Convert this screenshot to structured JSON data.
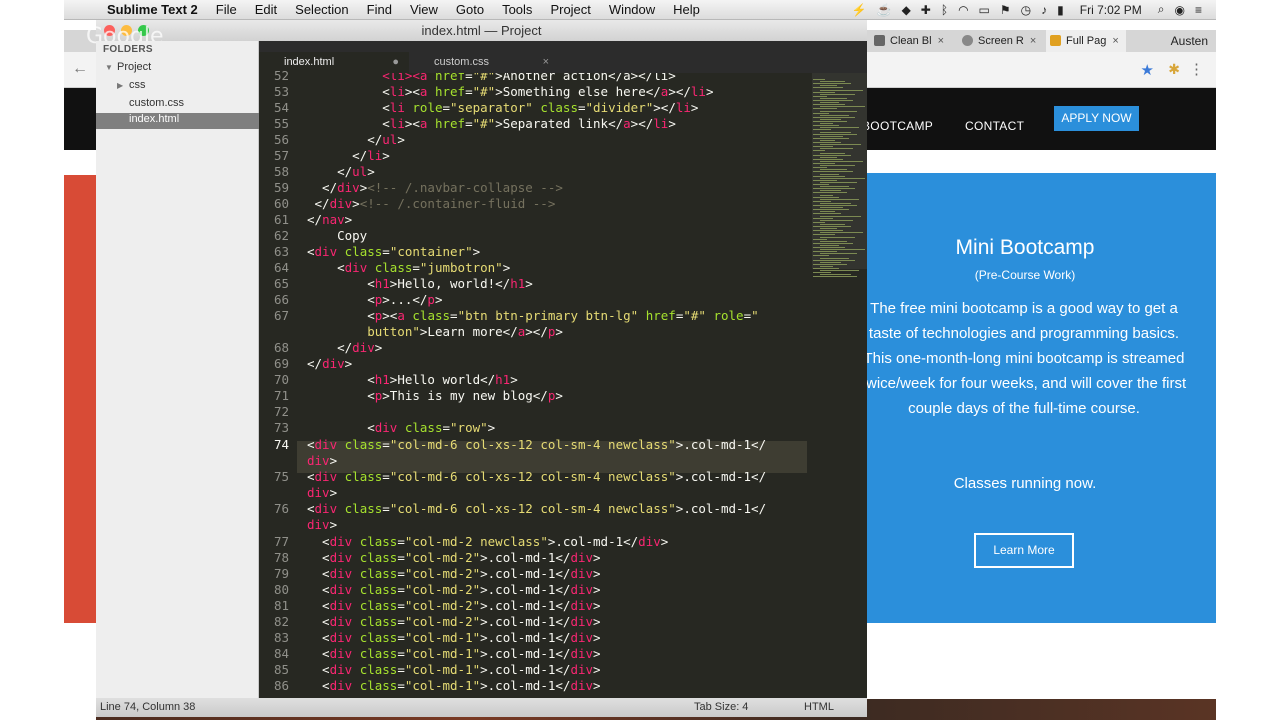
{
  "menubar": {
    "app": "Sublime Text 2",
    "items": [
      "File",
      "Edit",
      "Selection",
      "Find",
      "View",
      "Goto",
      "Tools",
      "Project",
      "Window",
      "Help"
    ],
    "clock": "Fri 7:02 PM"
  },
  "browser": {
    "tabs": [
      "Clean Bl",
      "Screen R",
      "Full Pag"
    ],
    "user": "Austen",
    "nav": {
      "bootcamp": "BOOTCAMP",
      "contact": "CONTACT",
      "apply": "APPLY NOW"
    },
    "hero": {
      "title": "Mini Bootcamp",
      "subtitle": "(Pre-Course Work)",
      "body": "The free mini bootcamp is a good way to get a taste of technologies and programming basics. This one-month-long mini bootcamp is streamed twice/week for four weeks, and will cover the first couple days of the full-time course.",
      "note": "Classes running now.",
      "button": "Learn More"
    },
    "colors": {
      "nav": "#111111",
      "hero": "#2b8fdb",
      "red": "#d84b36"
    }
  },
  "sublime": {
    "title": "index.html — Project",
    "overlay": "Google",
    "sidebar": {
      "header": "FOLDERS",
      "project": "Project",
      "items": [
        "css",
        "custom.css",
        "index.html"
      ],
      "selected": "index.html"
    },
    "tabs": [
      {
        "label": "index.html",
        "active": true
      },
      {
        "label": "custom.css",
        "active": false
      }
    ],
    "status": {
      "position": "Line 74, Column 38",
      "tab_size": "Tab Size: 4",
      "syntax": "HTML"
    },
    "line_numbers": [
      "52",
      "53",
      "54",
      "55",
      "56",
      "57",
      "58",
      "59",
      "60",
      "61",
      "62",
      "63",
      "64",
      "65",
      "66",
      "67",
      "",
      "68",
      "69",
      "70",
      "71",
      "72",
      "73",
      "74",
      "",
      "75",
      "",
      "76",
      "",
      "77",
      "78",
      "79",
      "80",
      "81",
      "82",
      "83",
      "84",
      "85",
      "86"
    ],
    "current_line": "74"
  }
}
